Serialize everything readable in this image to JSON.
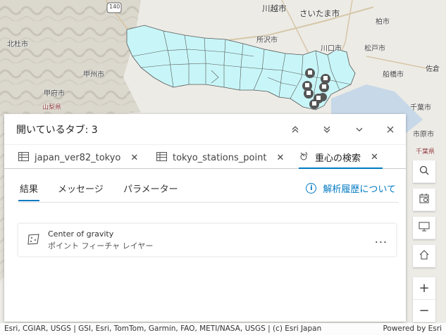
{
  "map": {
    "labels": {
      "kawagoe": "川越市",
      "saitama": "さいたま市",
      "kashiwa": "柏市",
      "hokuto": "北杜市",
      "tokorozawa": "所沢市",
      "kawaguchi": "川口市",
      "matsudo": "松戸市",
      "kofu": "甲州市",
      "funabashi": "船橋市",
      "sakura": "佐倉",
      "kofushi": "甲府市",
      "yamanashi": "山梨県",
      "chiba": "千葉市",
      "ichihara": "市原市",
      "chibaken": "千葉県",
      "route": "140"
    },
    "colors": {
      "polygon_fill": "#c8f6f8",
      "polygon_stroke": "#555555",
      "water": "#c7d8e8"
    }
  },
  "panel": {
    "title": "開いているタブ: 3",
    "tabs": [
      {
        "label": "japan_ver82_tokyo",
        "icon": "table-icon"
      },
      {
        "label": "tokyo_stations_point",
        "icon": "table-icon"
      },
      {
        "label": "重心の検索",
        "icon": "analysis-icon"
      }
    ],
    "subtabs": [
      "結果",
      "メッセージ",
      "パラメーター"
    ],
    "about": "解析履歴について",
    "result": {
      "title": "Center of gravity",
      "subtitle": "ポイント フィーチャ レイヤー",
      "more": "..."
    }
  },
  "attribution": "Esri, CGIAR, USGS | GSI, Esri, TomTom, Garmin, FAO, METI/NASA, USGS | (c) Esri Japan",
  "powered": "Powered by Esri"
}
